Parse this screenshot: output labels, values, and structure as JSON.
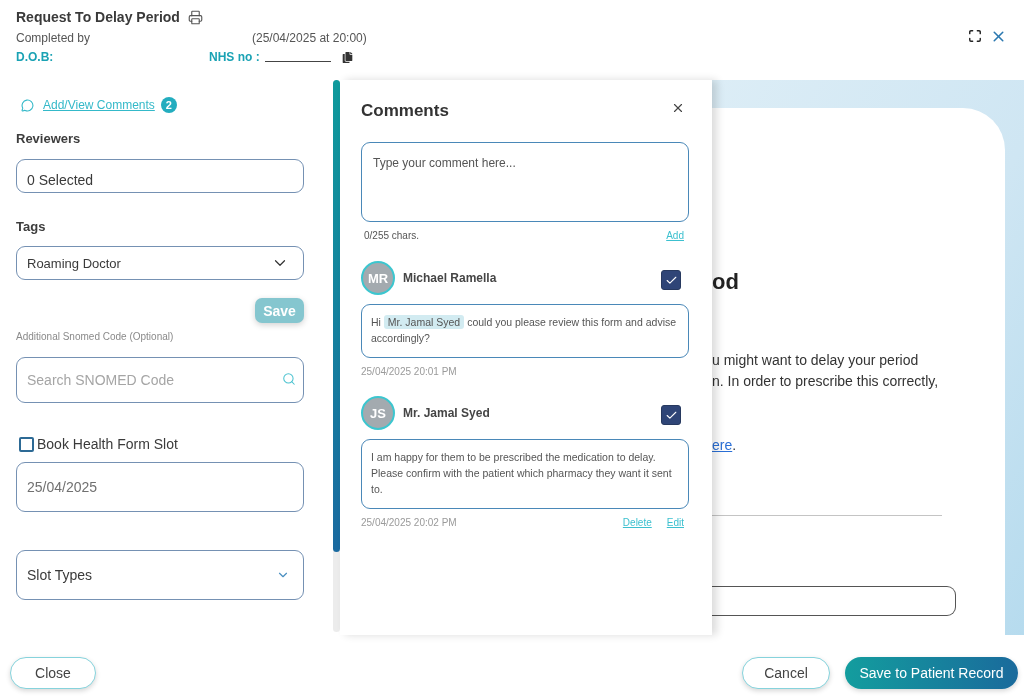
{
  "header": {
    "title": "Request To Delay Period",
    "completed_by_label": "Completed by",
    "completed_at": "(25/04/2025 at 20:00)",
    "dob_label": "D.O.B:",
    "nhs_label": "NHS no :"
  },
  "sidebar": {
    "comments_link": {
      "label": "Add/View Comments",
      "count": "2"
    },
    "reviewers": {
      "label": "Reviewers",
      "value": "0 Selected"
    },
    "tags": {
      "label": "Tags",
      "value": "Roaming Doctor"
    },
    "save_button": {
      "label": "Save",
      "disabled": true
    },
    "snomed": {
      "label": "Additional Snomed Code (Optional)",
      "placeholder": "Search SNOMED Code"
    },
    "book_slot": {
      "label": "Book Health Form Slot",
      "checked": false
    },
    "date": {
      "value": "25/04/2025"
    },
    "slot_types": {
      "label": "Slot Types"
    }
  },
  "comments_panel": {
    "title": "Comments",
    "input": {
      "placeholder": "Type your comment here..."
    },
    "char_count": "0/255 chars.",
    "add_link": "Add",
    "comments": [
      {
        "initials": "MR",
        "author": "Michael Ramella",
        "checked": true,
        "body": [
          {
            "kind": "text",
            "text": "Hi"
          },
          {
            "kind": "mention",
            "text": "Mr. Jamal Syed"
          },
          {
            "kind": "text",
            "text": "could you please review this form and advise accordingly?"
          }
        ],
        "time": "25/04/2025 20:01 PM"
      },
      {
        "initials": "JS",
        "author": "Mr. Jamal Syed",
        "checked": true,
        "body": [
          {
            "kind": "text",
            "text": "I am happy for them to be prescribed the medication to delay. Please confirm with the patient which pharmacy they want it sent to."
          }
        ],
        "time": "25/04/2025 20:02 PM",
        "actions": [
          "Delete",
          "Edit"
        ]
      }
    ]
  },
  "form_preview": {
    "heading": "od",
    "lines": [
      "u might want to delay your period",
      "n. In order to prescribe this correctly,"
    ],
    "link": {
      "text": "ere",
      "suffix": "."
    }
  },
  "footer": {
    "close": "Close",
    "cancel": "Cancel",
    "save": "Save to Patient Record"
  }
}
